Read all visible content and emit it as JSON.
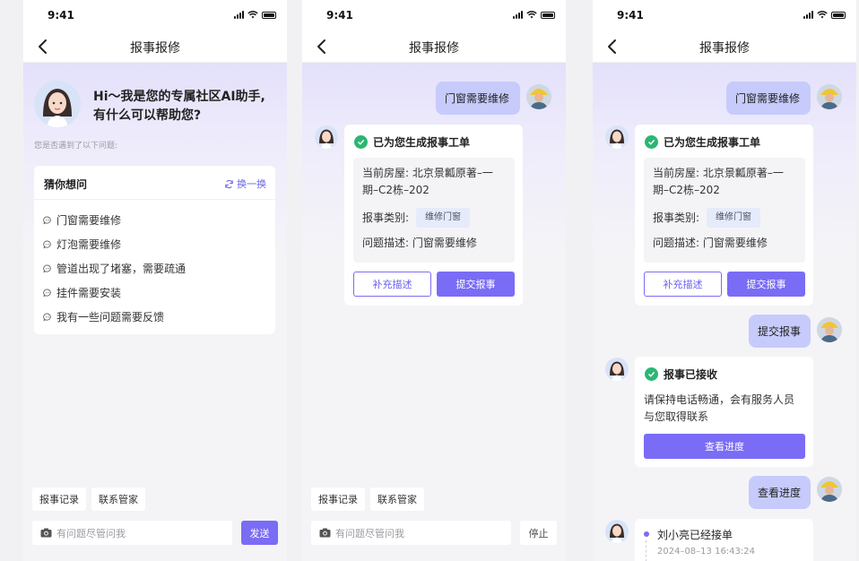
{
  "status_time": "9:41",
  "nav_title": "报事报修",
  "s1": {
    "greeting_line1": "Hi～我是您的专属社区AI助手,",
    "greeting_line2": "有什么可以帮助您?",
    "hint": "您是否遇到了以下问题:",
    "guess_title": "猜你想问",
    "swap_label": "换一换",
    "questions": [
      "门窗需要维修",
      "灯泡需要维修",
      "管道出现了堵塞，需要疏通",
      "挂件需要安装",
      "我有一些问题需要反馈"
    ]
  },
  "chips": [
    "报事记录",
    "联系管家"
  ],
  "input_placeholder": "有问题尽管问我",
  "send_label": "发送",
  "stop_label": "停止",
  "user_msg1": "门窗需要维修",
  "ticket": {
    "title": "已为您生成报事工单",
    "house_label": "当前房屋:",
    "house_value_line1": "北京景瓤原著–一",
    "house_value_line2": "期–C2栋–202",
    "type_label": "报事类别:",
    "type_value": "维修门窗",
    "desc_label": "问题描述:",
    "desc_value": "门窗需要维修",
    "supplement_btn": "补充描述",
    "submit_btn": "提交报事"
  },
  "user_msg2": "提交报事",
  "received": {
    "title": "报事已接收",
    "line1": "请保持电话畅通，会有服务人员",
    "line2": "与您取得联系",
    "button": "查看进度"
  },
  "user_msg3": "查看进度",
  "progress": {
    "text": "刘小亮已经接单",
    "time": "2024–08–13 16:43:24"
  },
  "colors": {
    "accent": "#7a6cf5",
    "success": "#2bb673",
    "user_bubble": "#c6cbfb"
  }
}
